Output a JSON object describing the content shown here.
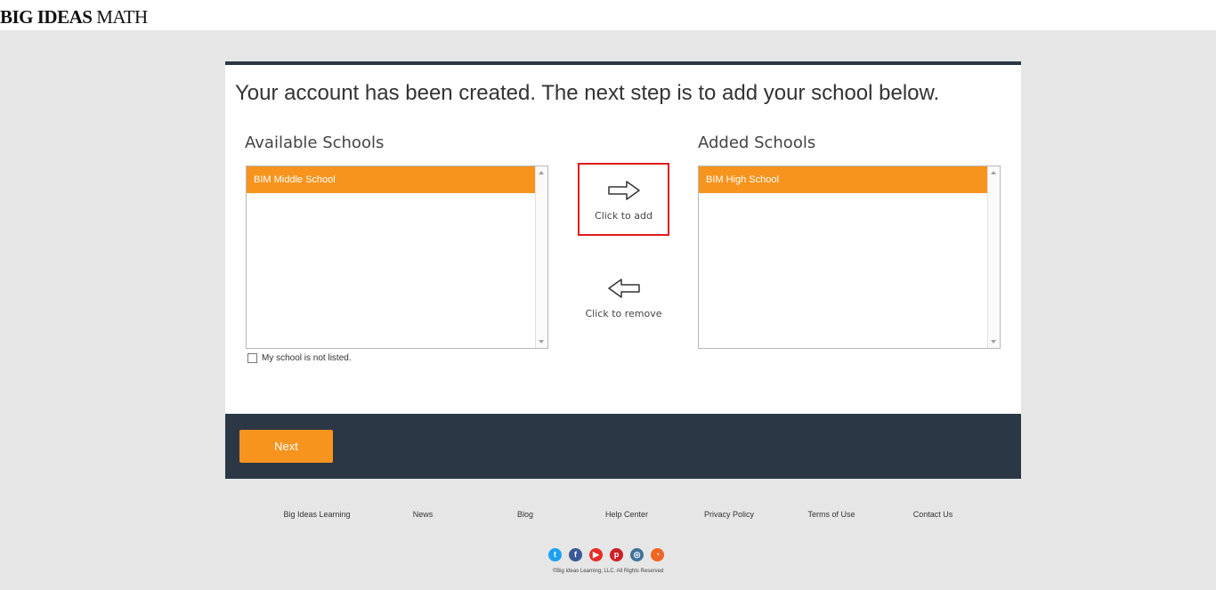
{
  "logo": {
    "bold": "BIG IDEAS",
    "rest": " MATH"
  },
  "card": {
    "headline": "Your account has been created. The next step is to add your school below.",
    "available_title": "Available Schools",
    "added_title": "Added Schools",
    "available_items": [
      "BIM Middle School"
    ],
    "added_items": [
      "BIM High School"
    ],
    "not_listed": "My school is not listed.",
    "add_label": "Click to add",
    "remove_label": "Click to remove"
  },
  "footer": {
    "next_label": "Next",
    "links": [
      "Big Ideas Learning",
      "News",
      "Blog",
      "Help Center",
      "Privacy Policy",
      "Terms of Use",
      "Contact Us"
    ],
    "copyright": "©Big Ideas Learning, LLC. All Rights Reserved"
  },
  "social": {
    "twitter": "t",
    "facebook": "f",
    "youtube": "▶",
    "pinterest": "p",
    "instagram": "◎",
    "rss": "◔"
  },
  "colors": {
    "accent": "#f7941e",
    "dark": "#2b3744",
    "highlight": "#e01b1b"
  }
}
